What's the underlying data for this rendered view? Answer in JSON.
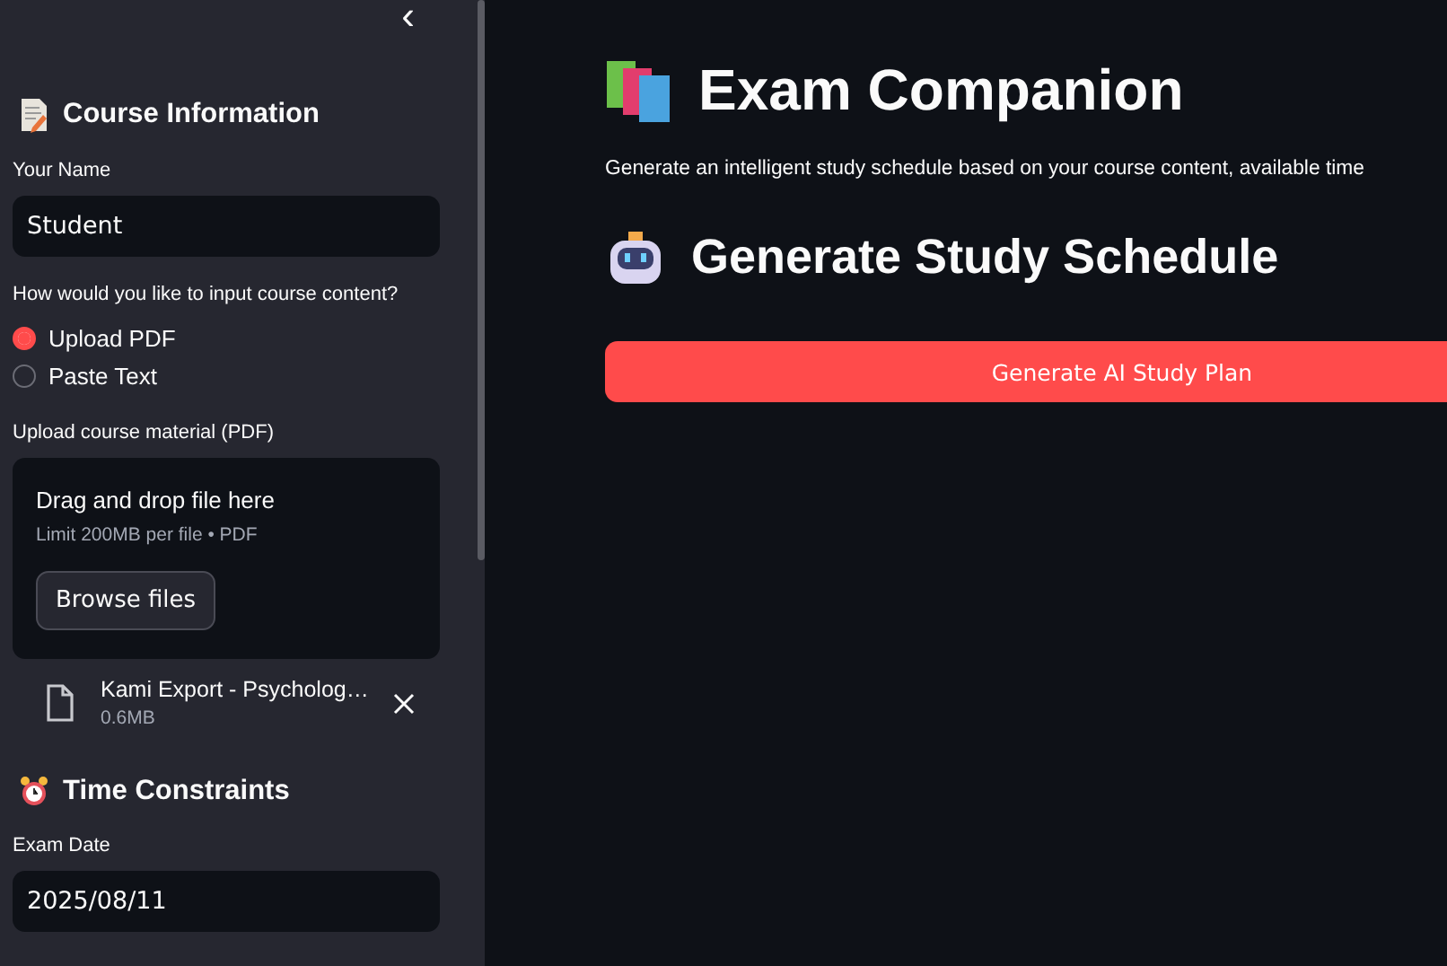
{
  "sidebar": {
    "collapse_icon": "‹",
    "sections": [
      {
        "kind": "course",
        "title": "Course Information"
      },
      {
        "kind": "time",
        "title": "Time Constraints"
      }
    ],
    "name_field": {
      "label": "Your Name",
      "value": "Student"
    },
    "input_method": {
      "label": "How would you like to input course content?",
      "options": [
        {
          "label": "Upload PDF",
          "selected": true
        },
        {
          "label": "Paste Text",
          "selected": false
        }
      ]
    },
    "uploader": {
      "label": "Upload course material (PDF)",
      "dropzone_title": "Drag and drop file here",
      "dropzone_hint": "Limit 200MB per file • PDF",
      "browse_button": "Browse files",
      "file": {
        "name": "Kami Export - Psycholog…",
        "size": "0.6MB"
      }
    },
    "exam_date": {
      "label": "Exam Date",
      "value": "2025/08/11"
    }
  },
  "main": {
    "title": "Exam Companion",
    "description": "Generate an intelligent study schedule based on your course content, available time",
    "section_title": "Generate Study Schedule",
    "generate_button": "Generate AI Study Plan"
  }
}
